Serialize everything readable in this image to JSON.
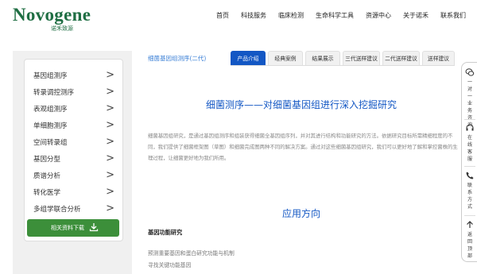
{
  "brand": {
    "name": "Novogene",
    "sub": "诺禾致源"
  },
  "nav": [
    "首页",
    "科技服务",
    "临床检测",
    "生命科学工具",
    "资源中心",
    "关于诺禾",
    "联系我们"
  ],
  "sidebar": {
    "items": [
      "基因组测序",
      "转录调控测序",
      "表观组测序",
      "单细胞测序",
      "空间转录组",
      "基因分型",
      "质谱分析",
      "转化医学",
      "多组学联合分析"
    ],
    "arrow": ">",
    "download": "相关资料下载"
  },
  "breadcrumb": "细菌基因组测序(二代)",
  "tabs": [
    "产品介绍",
    "经典案例",
    "结果展示",
    "三代送样建议",
    "二代送样建议",
    "送样建议"
  ],
  "main": {
    "title": "细菌测序——对细菌基因组进行深入挖掘研究",
    "paragraph": "细菌基因组研究，是通过基因组测序和组装获得细菌全基因组序列，并对其进行结构和功能研究的方法。依据研究目标所需精细程度的不同，我们提供了细菌框架图（草图）和细菌完成图两种不同的解决方案。通过对这些细菌基因组研究，我们可以更好地了解和掌控菌株的生理过程，让细菌更好地为我们所用。",
    "section2": "应用方向",
    "subhead": "基因功能研究",
    "bullets": [
      "预测重要基因和蛋白研究功能与机制",
      "寻找关键功能基因"
    ]
  },
  "floatbar": [
    "一对一业务咨询",
    "在线客服",
    "联系方式",
    "返回顶部"
  ],
  "colors": {
    "brand_green": "#1f6e43",
    "accent_blue": "#1357c4",
    "button_green": "#3c8f3a"
  }
}
